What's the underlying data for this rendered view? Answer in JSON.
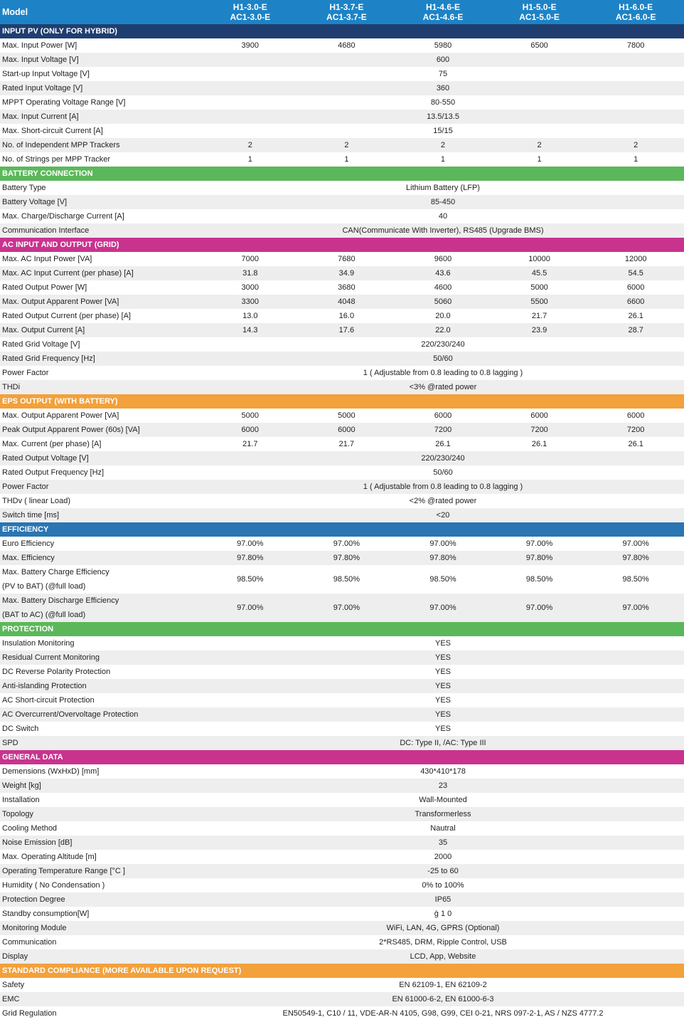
{
  "header": {
    "label": "Model",
    "models": [
      [
        "H1-3.0-E",
        "AC1-3.0-E"
      ],
      [
        "H1-3.7-E",
        "AC1-3.7-E"
      ],
      [
        "H1-4.6-E",
        "AC1-4.6-E"
      ],
      [
        "H1-5.0-E",
        "AC1-5.0-E"
      ],
      [
        "H1-6.0-E",
        "AC1-6.0-E"
      ]
    ]
  },
  "colors": {
    "header": "#1d83c6",
    "navy": "#1f3e6f",
    "green": "#5bb85a",
    "magenta": "#c9338e",
    "orange": "#f2a13b",
    "blue": "#2a75b3",
    "row_alt": "#eeeeee"
  },
  "sections": [
    {
      "title": "INPUT PV (ONLY FOR HYBRID)",
      "color": "navy",
      "rows": [
        {
          "label": "Max. Input Power [W]",
          "values": [
            "3900",
            "4680",
            "5980",
            "6500",
            "7800"
          ]
        },
        {
          "label": "Max. Input Voltage  [V]",
          "span": "600"
        },
        {
          "label": "Start-up Input Voltage [V]",
          "span": "75"
        },
        {
          "label": "Rated Input Voltage [V]",
          "span": "360"
        },
        {
          "label": "MPPT Operating Voltage Range [V]",
          "span": "80-550"
        },
        {
          "label": "Max. Input Current [A]",
          "span": "13.5/13.5"
        },
        {
          "label": "Max. Short-circuit Current [A]",
          "span": "15/15"
        },
        {
          "label": "No. of Independent MPP Trackers",
          "values": [
            "2",
            "2",
            "2",
            "2",
            "2"
          ]
        },
        {
          "label": "No. of Strings per MPP Tracker",
          "values": [
            "1",
            "1",
            "1",
            "1",
            "1"
          ]
        }
      ]
    },
    {
      "title": "BATTERY CONNECTION",
      "color": "green",
      "rows": [
        {
          "label": "Battery Type",
          "span": "Lithium Battery (LFP)"
        },
        {
          "label": "Battery Voltage [V]",
          "span": "85-450"
        },
        {
          "label": "Max. Charge/Discharge Current [A]",
          "span": "40"
        },
        {
          "label": "Communication Interface",
          "span": "CAN(Communicate With Inverter), RS485 (Upgrade BMS)"
        }
      ]
    },
    {
      "title": "AC INPUT AND OUTPUT (GRID)",
      "color": "magenta",
      "rows": [
        {
          "label": "Max. AC Input Power [VA]",
          "values": [
            "7000",
            "7680",
            "9600",
            "10000",
            "12000"
          ]
        },
        {
          "label": "Max. AC Input Current (per phase) [A]",
          "values": [
            "31.8",
            "34.9",
            "43.6",
            "45.5",
            "54.5"
          ]
        },
        {
          "label": "Rated Output Power [W]",
          "values": [
            "3000",
            "3680",
            "4600",
            "5000",
            "6000"
          ]
        },
        {
          "label": "Max. Output Apparent Power [VA]",
          "values": [
            "3300",
            "4048",
            "5060",
            "5500",
            "6600"
          ]
        },
        {
          "label": "Rated Output Current (per phase) [A]",
          "values": [
            "13.0",
            "16.0",
            "20.0",
            "21.7",
            "26.1"
          ]
        },
        {
          "label": "Max. Output Current [A]",
          "values": [
            "14.3",
            "17.6",
            "22.0",
            "23.9",
            "28.7"
          ]
        },
        {
          "label": "Rated Grid Voltage [V]",
          "span": "220/230/240"
        },
        {
          "label": "Rated Grid Frequency [Hz]",
          "span": "50/60"
        },
        {
          "label": "Power Factor",
          "span": "1 ( Adjustable from 0.8 leading to 0.8 lagging )"
        },
        {
          "label": "THDi",
          "span": "<3% @rated power"
        }
      ]
    },
    {
      "title": "EPS OUTPUT (WITH BATTERY)",
      "color": "orange",
      "rows": [
        {
          "label": "Max. Output Apparent Power [VA]",
          "values": [
            "5000",
            "5000",
            "6000",
            "6000",
            "6000"
          ]
        },
        {
          "label": "Peak Output Apparent Power (60s) [VA]",
          "values": [
            "6000",
            "6000",
            "7200",
            "7200",
            "7200"
          ]
        },
        {
          "label": "Max. Current (per phase) [A]",
          "values": [
            "21.7",
            "21.7",
            "26.1",
            "26.1",
            "26.1"
          ]
        },
        {
          "label": "Rated Output Voltage [V]",
          "span": "220/230/240"
        },
        {
          "label": "Rated Output Frequency [Hz]",
          "span": "50/60"
        },
        {
          "label": "Power Factor",
          "span": "1 ( Adjustable from 0.8 leading to 0.8 lagging )"
        },
        {
          "label": "THDv ( linear Load)",
          "span": "<2% @rated power"
        },
        {
          "label": "Switch time [ms]",
          "span": "<20"
        }
      ]
    },
    {
      "title": "EFFICIENCY",
      "color": "blue",
      "rows": [
        {
          "label": "Euro Efficiency",
          "values": [
            "97.00%",
            "97.00%",
            "97.00%",
            "97.00%",
            "97.00%"
          ]
        },
        {
          "label": "Max. Efficiency",
          "values": [
            "97.80%",
            "97.80%",
            "97.80%",
            "97.80%",
            "97.80%"
          ]
        },
        {
          "label": "Max. Battery Charge Efficiency",
          "label2": "(PV to BAT) (@full load)",
          "values": [
            "98.50%",
            "98.50%",
            "98.50%",
            "98.50%",
            "98.50%"
          ]
        },
        {
          "label": "Max. Battery Discharge Efficiency",
          "label2": "(BAT to AC) (@full load)",
          "values": [
            "97.00%",
            "97.00%",
            "97.00%",
            "97.00%",
            "97.00%"
          ]
        }
      ]
    },
    {
      "title": "PROTECTION",
      "color": "green",
      "rows": [
        {
          "label": "Insulation Monitoring",
          "span": "YES"
        },
        {
          "label": "Residual Current Monitoring",
          "span": "YES"
        },
        {
          "label": "DC Reverse Polarity Protection",
          "span": "YES"
        },
        {
          "label": "Anti-islanding Protection",
          "span": "YES"
        },
        {
          "label": "AC Short-circuit Protection",
          "span": "YES"
        },
        {
          "label": "AC Overcurrent/Overvoltage Protection",
          "span": "YES"
        },
        {
          "label": "DC Switch",
          "span": "YES"
        },
        {
          "label": "SPD",
          "span": "DC: Type II, /AC: Type III"
        }
      ]
    },
    {
      "title": "GENERAL DATA",
      "color": "magenta",
      "rows": [
        {
          "label": "Demensions (WxHxD) [mm]",
          "span": "430*410*178"
        },
        {
          "label": "Weight [kg]",
          "span": "23"
        },
        {
          "label": "Installation",
          "span": "Wall-Mounted"
        },
        {
          "label": "Topology",
          "span": "Transformerless"
        },
        {
          "label": "Cooling Method",
          "span": "Nautral"
        },
        {
          "label": "Noise Emission [dB]",
          "span": "35"
        },
        {
          "label": "Max. Operating Altitude [m]",
          "span": "2000"
        },
        {
          "label": "Operating Temperature Range [°C ]",
          "span": "-25 to 60"
        },
        {
          "label": "Humidity ( No Condensation )",
          "span": "0% to 100%"
        },
        {
          "label": "Protection Degree",
          "span": "IP65"
        },
        {
          "label": "Standby consumption[W]",
          "span": "ģ 1 0"
        },
        {
          "label": "Monitoring Module",
          "span": "WiFi, LAN, 4G, GPRS (Optional)"
        },
        {
          "label": "Communication",
          "span": "2*RS485, DRM, Ripple Control, USB"
        },
        {
          "label": "Display",
          "span": "LCD, App, Website"
        }
      ]
    },
    {
      "title": "STANDARD COMPLIANCE (MORE AVAILABLE UPON REQUEST)",
      "color": "orange",
      "rows": [
        {
          "label": "Safety",
          "span": "EN 62109-1, EN 62109-2"
        },
        {
          "label": "EMC",
          "span": "EN 61000-6-2, EN 61000-6-3"
        },
        {
          "label": "Grid Regulation",
          "span": "EN50549-1, C10 / 11, VDE-AR-N 4105, G98, G99, CEI 0-21, NRS 097-2-1, AS / NZS 4777.2"
        }
      ]
    }
  ]
}
